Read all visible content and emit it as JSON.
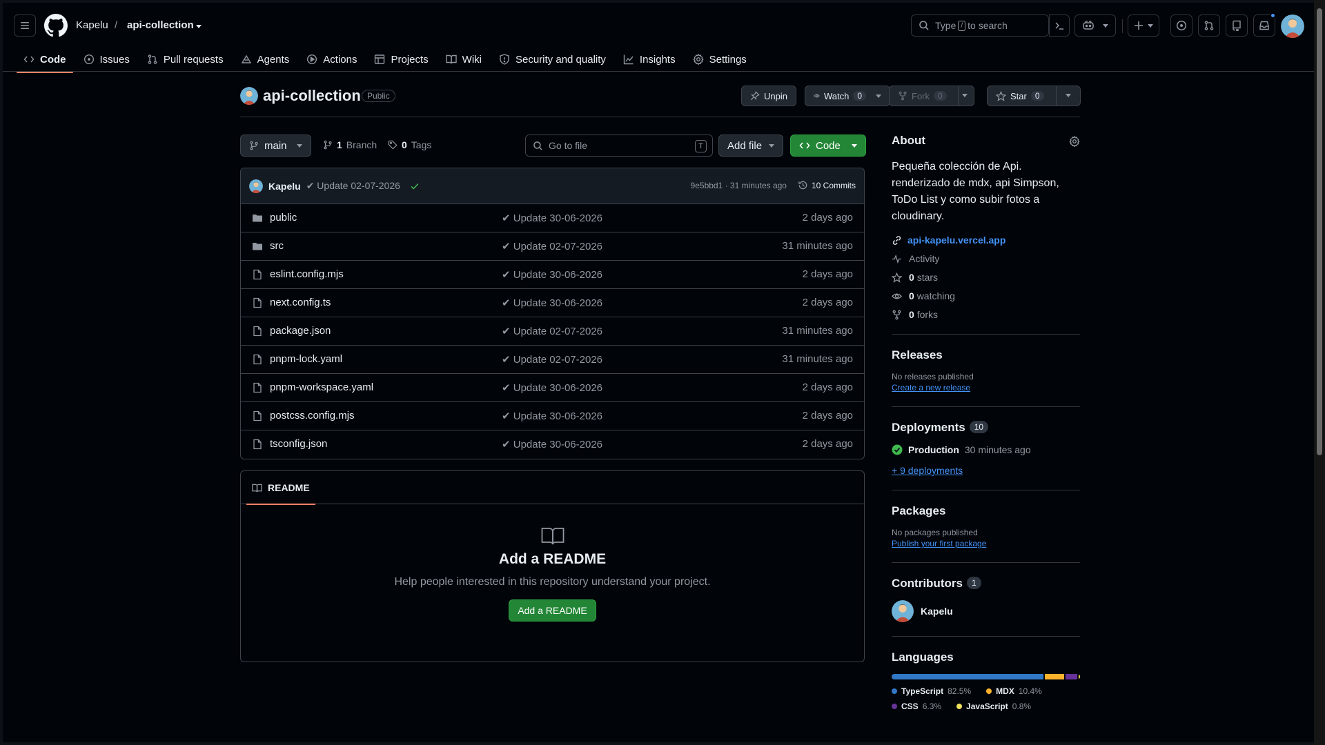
{
  "header": {
    "owner": "Kapelu",
    "separator": "/",
    "repo": "api-collection",
    "search_prefix": "Type",
    "search_key": "/",
    "search_suffix": "to search"
  },
  "tabs": [
    {
      "label": "Code",
      "icon": "code-icon",
      "active": true
    },
    {
      "label": "Issues",
      "icon": "issue-icon"
    },
    {
      "label": "Pull requests",
      "icon": "pull-request-icon"
    },
    {
      "label": "Agents",
      "icon": "agents-icon"
    },
    {
      "label": "Actions",
      "icon": "play-icon"
    },
    {
      "label": "Projects",
      "icon": "table-icon"
    },
    {
      "label": "Wiki",
      "icon": "book-icon"
    },
    {
      "label": "Security and quality",
      "icon": "shield-icon"
    },
    {
      "label": "Insights",
      "icon": "graph-icon"
    },
    {
      "label": "Settings",
      "icon": "gear-icon"
    }
  ],
  "repo_head": {
    "title": "api-collection",
    "visibility": "Public",
    "unpin": "Unpin",
    "watch": "Watch",
    "watch_count": "0",
    "fork": "Fork",
    "fork_count": "0",
    "star": "Star",
    "star_count": "0"
  },
  "toolbar": {
    "branch": "main",
    "branch_count": "1",
    "branch_label": "Branch",
    "tag_count": "0",
    "tag_label": "Tags",
    "goto_placeholder": "Go to file",
    "goto_key": "T",
    "add_file": "Add file",
    "code": "Code"
  },
  "commit": {
    "author": "Kapelu",
    "message": "✔ Update 02-07-2026",
    "sha_time": "9e5bbd1 · 31 minutes ago",
    "commits": "10 Commits"
  },
  "files": [
    {
      "name": "public",
      "type": "dir",
      "message": "✔ Update 30-06-2026",
      "time": "2 days ago"
    },
    {
      "name": "src",
      "type": "dir",
      "message": "✔ Update 02-07-2026",
      "time": "31 minutes ago"
    },
    {
      "name": "eslint.config.mjs",
      "type": "file",
      "message": "✔ Update 30-06-2026",
      "time": "2 days ago"
    },
    {
      "name": "next.config.ts",
      "type": "file",
      "message": "✔ Update 30-06-2026",
      "time": "2 days ago"
    },
    {
      "name": "package.json",
      "type": "file",
      "message": "✔ Update 02-07-2026",
      "time": "31 minutes ago"
    },
    {
      "name": "pnpm-lock.yaml",
      "type": "file",
      "message": "✔ Update 02-07-2026",
      "time": "31 minutes ago"
    },
    {
      "name": "pnpm-workspace.yaml",
      "type": "file",
      "message": "✔ Update 30-06-2026",
      "time": "2 days ago"
    },
    {
      "name": "postcss.config.mjs",
      "type": "file",
      "message": "✔ Update 30-06-2026",
      "time": "2 days ago"
    },
    {
      "name": "tsconfig.json",
      "type": "file",
      "message": "✔ Update 30-06-2026",
      "time": "2 days ago"
    }
  ],
  "readme": {
    "tab": "README",
    "title": "Add a README",
    "subtitle": "Help people interested in this repository understand your project.",
    "button": "Add a README"
  },
  "about": {
    "title": "About",
    "description": "Pequeña colección de Api. renderizado de mdx, api Simpson, ToDo List y como subir fotos a cloudinary.",
    "homepage": "api-kapelu.vercel.app",
    "activity": "Activity",
    "stars_count": "0",
    "stars_label": "stars",
    "watching_count": "0",
    "watching_label": "watching",
    "forks_count": "0",
    "forks_label": "forks"
  },
  "releases": {
    "title": "Releases",
    "empty": "No releases published",
    "link": "Create a new release"
  },
  "deployments": {
    "title": "Deployments",
    "count": "10",
    "env": "Production",
    "time": "30 minutes ago",
    "more": "+ 9 deployments"
  },
  "packages": {
    "title": "Packages",
    "empty": "No packages published",
    "link": "Publish your first package"
  },
  "contributors": {
    "title": "Contributors",
    "count": "1",
    "name": "Kapelu"
  },
  "languages": {
    "title": "Languages",
    "items": [
      {
        "name": "TypeScript",
        "percent": "82.5%",
        "value": 82.5,
        "color": "#3178c6"
      },
      {
        "name": "MDX",
        "percent": "10.4%",
        "value": 10.4,
        "color": "#fcb32c"
      },
      {
        "name": "CSS",
        "percent": "6.3%",
        "value": 6.3,
        "color": "#663399"
      },
      {
        "name": "JavaScript",
        "percent": "0.8%",
        "value": 0.8,
        "color": "#f1e05a"
      }
    ]
  },
  "colors": {
    "accent_link": "#4493f8",
    "primary_button": "#238636",
    "active_tab": "#f78166",
    "success": "#3fb950"
  }
}
